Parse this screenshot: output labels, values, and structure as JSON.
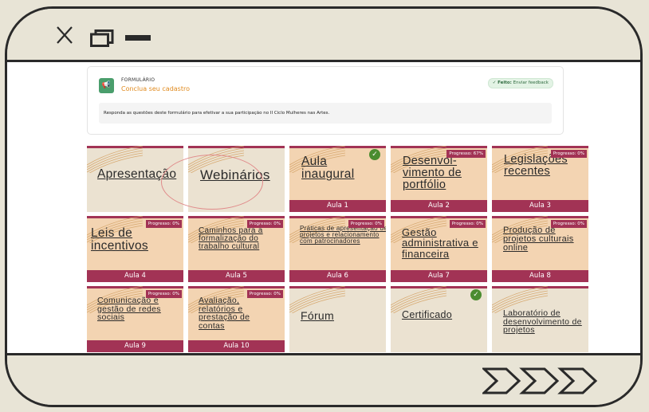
{
  "window": {
    "close_label": "X"
  },
  "form": {
    "section_label": "FORMULÁRIO",
    "link_text": "Conclua seu cadastro",
    "feedback_badge": {
      "prefix": "✓ ",
      "bold": "Feito:",
      "text": " Enviar feedback"
    },
    "description": "Responda as questões deste formulário para efetivar a sua participação no II Ciclo Mulheres nas Artes."
  },
  "tiles": [
    {
      "title": "Apresentação",
      "bottom": "",
      "badge": "",
      "check": false,
      "color": "beige"
    },
    {
      "title": "Webinários",
      "bottom": "",
      "badge": "",
      "check": false,
      "color": "beige"
    },
    {
      "title": "Aula inaugural",
      "bottom": "Aula 1",
      "badge": "",
      "check": true,
      "color": "peach"
    },
    {
      "title": "Desenvol-vimento de portfólio",
      "bottom": "Aula 2",
      "badge": "Progresso: 67%",
      "check": false,
      "color": "peach"
    },
    {
      "title": "Legislações recentes",
      "bottom": "Aula 3",
      "badge": "Progresso: 0%",
      "check": false,
      "color": "peach"
    },
    {
      "title": "Leis de incentivos",
      "bottom": "Aula 4",
      "badge": "Progresso: 0%",
      "check": false,
      "color": "peach"
    },
    {
      "title": "Caminhos para a formalização do trabalho cultural",
      "bottom": "Aula 5",
      "badge": "Progresso: 0%",
      "check": false,
      "color": "peach"
    },
    {
      "title": "Práticas de apresentação de projetos e relacionamento com patrocinadores",
      "bottom": "Aula 6",
      "badge": "Progresso: 0%",
      "check": false,
      "color": "peach"
    },
    {
      "title": "Gestão administrativa e financeira",
      "bottom": "Aula 7",
      "badge": "Progresso: 0%",
      "check": false,
      "color": "peach"
    },
    {
      "title": "Produção de projetos culturais online",
      "bottom": "Aula 8",
      "badge": "Progresso: 0%",
      "check": false,
      "color": "peach"
    },
    {
      "title": "Comunicação e gestão de redes sociais",
      "bottom": "Aula 9",
      "badge": "Progresso: 0%",
      "check": false,
      "color": "peach"
    },
    {
      "title": "Avaliação, relatórios e prestação de contas",
      "bottom": "Aula 10",
      "badge": "Progresso: 0%",
      "check": false,
      "color": "peach"
    },
    {
      "title": "Fórum",
      "bottom": "",
      "badge": "",
      "check": false,
      "color": "beige"
    },
    {
      "title": "Certificado",
      "bottom": "",
      "badge": "",
      "check": true,
      "color": "beige"
    },
    {
      "title": "Laboratório de desenvolvimento de projetos",
      "bottom": "",
      "badge": "",
      "check": false,
      "color": "beige"
    }
  ],
  "colors": {
    "accent": "#a23355",
    "peach": "#f3d4b2",
    "beige": "#ebe2d1",
    "check": "#4a8c2f",
    "link": "#e08a1e"
  }
}
